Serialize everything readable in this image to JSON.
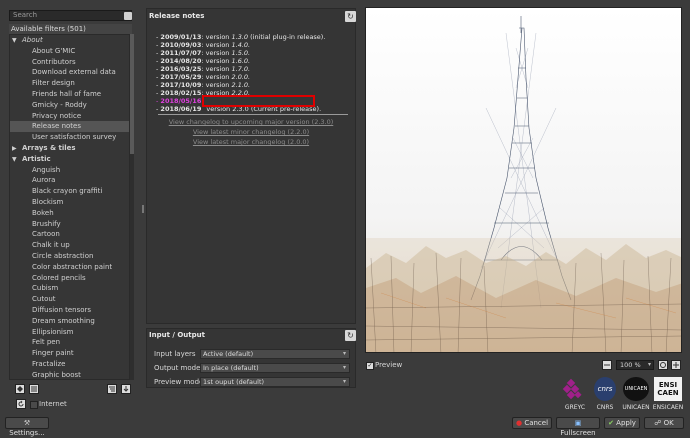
{
  "search": {
    "placeholder": "Search"
  },
  "filters_header": "Available filters (501)",
  "tree": [
    {
      "label": "About",
      "level": "cat-open-italic"
    },
    {
      "label": "About G'MIC",
      "level": 1
    },
    {
      "label": "Contributors",
      "level": 1
    },
    {
      "label": "Download external data",
      "level": 1
    },
    {
      "label": "Filter design",
      "level": 1
    },
    {
      "label": "Friends hall of fame",
      "level": 1
    },
    {
      "label": "Gmicky - Roddy",
      "level": 1
    },
    {
      "label": "Privacy notice",
      "level": 1
    },
    {
      "label": "Release notes",
      "level": 1,
      "selected": true
    },
    {
      "label": "User satisfaction survey",
      "level": 1
    },
    {
      "label": "Arrays & tiles",
      "level": "cat-closed"
    },
    {
      "label": "Artistic",
      "level": "cat-open"
    },
    {
      "label": "Anguish",
      "level": 1
    },
    {
      "label": "Aurora",
      "level": 1
    },
    {
      "label": "Black crayon graffiti",
      "level": 1
    },
    {
      "label": "Blockism",
      "level": 1
    },
    {
      "label": "Bokeh",
      "level": 1
    },
    {
      "label": "Brushify",
      "level": 1
    },
    {
      "label": "Cartoon",
      "level": 1
    },
    {
      "label": "Chalk it up",
      "level": 1
    },
    {
      "label": "Circle abstraction",
      "level": 1
    },
    {
      "label": "Color abstraction paint",
      "level": 1
    },
    {
      "label": "Colored pencils",
      "level": 1
    },
    {
      "label": "Cubism",
      "level": 1
    },
    {
      "label": "Cutout",
      "level": 1
    },
    {
      "label": "Diffusion tensors",
      "level": 1
    },
    {
      "label": "Dream smoothing",
      "level": 1
    },
    {
      "label": "Ellipsionism",
      "level": 1
    },
    {
      "label": "Felt pen",
      "level": 1
    },
    {
      "label": "Finger paint",
      "level": 1
    },
    {
      "label": "Fractalize",
      "level": 1
    },
    {
      "label": "Graphic boost",
      "level": 1
    }
  ],
  "left_bottom": {
    "internet_label": "Internet"
  },
  "middle": {
    "title": "Release notes",
    "notes": [
      {
        "date": "2009/01/13",
        "text": ": version ",
        "ver": "1.3.0",
        "rest": " (initial plug-in release)."
      },
      {
        "date": "2010/09/03",
        "text": ": version ",
        "ver": "1.4.0.",
        "rest": ""
      },
      {
        "date": "2011/07/07",
        "text": ": version ",
        "ver": "1.5.0.",
        "rest": ""
      },
      {
        "date": "2014/08/20",
        "text": ": version ",
        "ver": "1.6.0.",
        "rest": ""
      },
      {
        "date": "2016/03/25",
        "text": ": version ",
        "ver": "1.7.0.",
        "rest": ""
      },
      {
        "date": "2017/05/29",
        "text": ": version ",
        "ver": "2.0.0.",
        "rest": ""
      },
      {
        "date": "2017/10/09",
        "text": ": version ",
        "ver": "2.1.0.",
        "rest": ""
      },
      {
        "date": "2018/02/15",
        "text": ": version ",
        "ver": "2.2.0.",
        "rest": ""
      },
      {
        "date": "2018/05/16",
        "text": "",
        "ver": "",
        "rest": "",
        "magenta": true
      },
      {
        "date": "2018/06/19",
        "text": "",
        "ver": "",
        "rest": "version 2.3.0 (Current pre-release)."
      }
    ],
    "links": [
      "View changelog to upcoming major version (2.3.0)",
      "View latest minor changelog (2.2.0)",
      "View latest major changelog (2.0.0)"
    ]
  },
  "io": {
    "title": "Input / Output",
    "rows": [
      {
        "label": "Input layers",
        "value": "Active (default)"
      },
      {
        "label": "Output mode",
        "value": "In place (default)"
      },
      {
        "label": "Preview mode",
        "value": "1st ouput (default)"
      }
    ]
  },
  "preview": {
    "label": "Preview",
    "zoom": "100 %"
  },
  "logos": [
    "GREYC",
    "CNRS",
    "UNICAEN",
    "ENSICAEN"
  ],
  "logo_texts": {
    "cnrs": "cnrs",
    "unicaen": "UNICAEN",
    "ensi1": "ENSI",
    "ensi2": "CAEN"
  },
  "buttons": {
    "settings": "Settings...",
    "cancel": "Cancel",
    "fullscreen": "Fullscreen",
    "apply": "Apply",
    "ok": "OK"
  },
  "colors": {
    "highlight": "#e00000",
    "magenta": "#e040e0"
  }
}
